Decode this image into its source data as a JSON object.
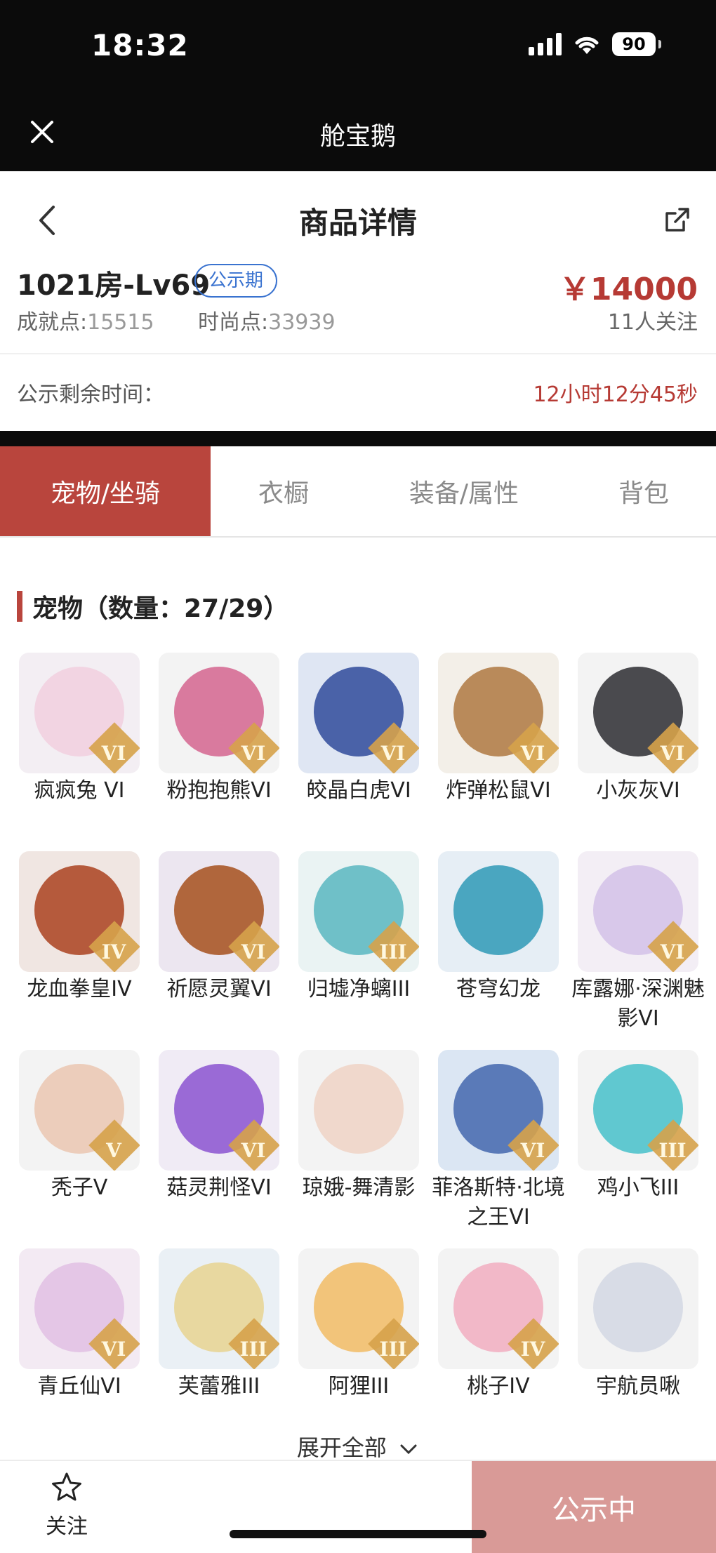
{
  "status_bar": {
    "time": "18:32",
    "battery": "90",
    "icons": [
      "signal-icon",
      "wifi-icon",
      "battery-icon"
    ]
  },
  "webview": {
    "title": "舱宝鹅",
    "close_icon": "close-icon"
  },
  "header": {
    "title": "商品详情",
    "back_icon": "back-icon",
    "share_icon": "share-icon"
  },
  "product": {
    "title": "1021房-Lv69",
    "badge": "公示期",
    "price": "￥14000",
    "achievement_label": "成就点:",
    "achievement_value": "15515",
    "fashion_label": "时尚点:",
    "fashion_value": "33939",
    "followers": "11人关注"
  },
  "countdown": {
    "label": "公示剩余时间：",
    "value": "12小时12分45秒"
  },
  "tabs": [
    {
      "label": "宠物/坐骑",
      "active": true
    },
    {
      "label": "衣橱",
      "active": false
    },
    {
      "label": "装备/属性",
      "active": false
    },
    {
      "label": "背包",
      "active": false
    }
  ],
  "section": {
    "title": "宠物（数量：27/29）"
  },
  "pets": [
    {
      "name": "疯疯兔 VI",
      "tier": "VI",
      "bg": "#f3eef3",
      "color": "#f2d4e2"
    },
    {
      "name": "粉抱抱熊VI",
      "tier": "VI",
      "bg": "#f3f3f3",
      "color": "#d97a9e"
    },
    {
      "name": "皎晶白虎VI",
      "tier": "VI",
      "bg": "#dfe6f3",
      "color": "#4a62a8"
    },
    {
      "name": "炸弹松鼠VI",
      "tier": "VI",
      "bg": "#f3efe8",
      "color": "#b98a5a"
    },
    {
      "name": "小灰灰VI",
      "tier": "VI",
      "bg": "#f3f3f3",
      "color": "#4a4a4e"
    },
    {
      "name": "龙血拳皇IV",
      "tier": "IV",
      "bg": "#f0e6e2",
      "color": "#b55a3c"
    },
    {
      "name": "祈愿灵翼VI",
      "tier": "VI",
      "bg": "#ece6f0",
      "color": "#b0663c"
    },
    {
      "name": "归墟净螭III",
      "tier": "III",
      "bg": "#eaf3f3",
      "color": "#6fc0c8"
    },
    {
      "name": "苍穹幻龙",
      "tier": "",
      "bg": "#e6eef5",
      "color": "#4aa6c0"
    },
    {
      "name": "库露娜·深渊魅影VI",
      "tier": "VI",
      "bg": "#f3eef5",
      "color": "#d8c8ea"
    },
    {
      "name": "秃子V",
      "tier": "V",
      "bg": "#f3f3f3",
      "color": "#eccdbb"
    },
    {
      "name": "菇灵荆怪VI",
      "tier": "VI",
      "bg": "#f0ebf5",
      "color": "#9a6ad6"
    },
    {
      "name": "琼娥-舞清影",
      "tier": "",
      "bg": "#f3f3f3",
      "color": "#f0d8cc"
    },
    {
      "name": "菲洛斯特·北境之王VI",
      "tier": "VI",
      "bg": "#dbe6f3",
      "color": "#5a7ab8"
    },
    {
      "name": "鸡小飞III",
      "tier": "III",
      "bg": "#f3f3f3",
      "color": "#60c8d0"
    },
    {
      "name": "青丘仙VI",
      "tier": "VI",
      "bg": "#f3eaf3",
      "color": "#e4c6e6"
    },
    {
      "name": "芙蕾雅III",
      "tier": "III",
      "bg": "#eaf0f5",
      "color": "#e8d8a0"
    },
    {
      "name": "阿狸III",
      "tier": "III",
      "bg": "#f3f3f3",
      "color": "#f2c47a"
    },
    {
      "name": "桃子IV",
      "tier": "IV",
      "bg": "#f3f3f3",
      "color": "#f2b8c8"
    },
    {
      "name": "宇航员啾",
      "tier": "",
      "bg": "#f3f3f3",
      "color": "#d8dce6"
    }
  ],
  "expand": {
    "label": "展开全部",
    "icon": "chevron-down-icon"
  },
  "bottom_bar": {
    "follow_label": "关注",
    "follow_icon": "star-icon",
    "cta_label": "公示中"
  },
  "colors": {
    "accent": "#b9453d",
    "price": "#b63a34",
    "badge": "#3a73d0",
    "cta": "#d99a97"
  }
}
